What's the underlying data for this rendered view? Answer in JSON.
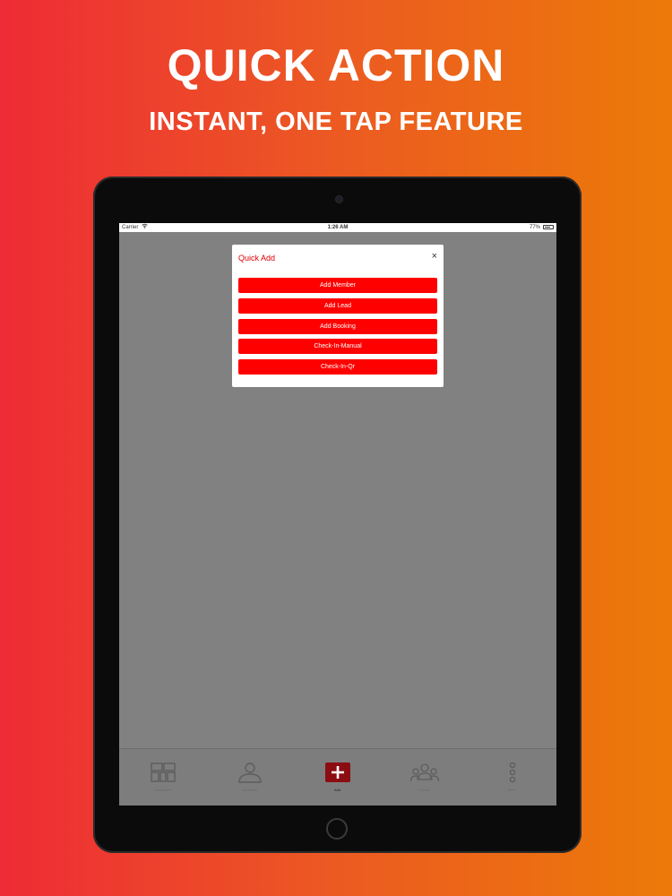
{
  "headline": {
    "title": "QUICK ACTION",
    "subtitle": "INSTANT, ONE TAP FEATURE"
  },
  "statusbar": {
    "carrier": "Carrier",
    "time": "1:26 AM",
    "battery": "77%",
    "battery_level": 0.77
  },
  "modal": {
    "title": "Quick Add",
    "close_symbol": "×",
    "actions": [
      {
        "label": "Add Member"
      },
      {
        "label": "Add Lead"
      },
      {
        "label": "Add Booking"
      },
      {
        "label": "Check-In-Manual"
      },
      {
        "label": "Check-In-Qr"
      }
    ]
  },
  "tabbar": {
    "items": [
      {
        "label": "Dashboard",
        "icon": "dashboard-icon"
      },
      {
        "label": "Members",
        "icon": "person-icon"
      },
      {
        "label": "Add",
        "icon": "plus-icon",
        "active": true
      },
      {
        "label": "Leads",
        "icon": "group-icon"
      },
      {
        "label": "More",
        "icon": "more-icon"
      }
    ]
  },
  "colors": {
    "accent": "#ff0000",
    "modal_title": "#e00000",
    "overlay": "#818181"
  }
}
